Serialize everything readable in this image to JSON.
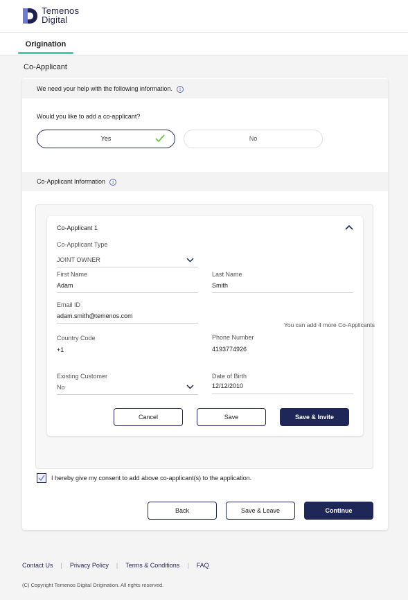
{
  "brand": {
    "name_line1": "Temenos",
    "name_line2": "Digital",
    "accent_color": "#3dcfab",
    "primary_color": "#1e2758"
  },
  "tabs": [
    {
      "label": "Origination",
      "active": true
    }
  ],
  "page_title": "Co-Applicant",
  "help_strip": {
    "text": "We need your help with the following information.",
    "icon": "info-icon"
  },
  "question": {
    "text": "Would you like to add a co-applicant?",
    "options": [
      {
        "label": "Yes",
        "selected": true,
        "icon": "check-icon"
      },
      {
        "label": "No",
        "selected": false
      }
    ]
  },
  "section_strip": {
    "text": "Co-Applicant Information",
    "icon": "info-icon"
  },
  "applicant": {
    "title": "Co-Applicant 1",
    "expanded_icon": "chevron-up-icon",
    "type": {
      "label": "Co-Applicant Type",
      "value": "JOINT OWNER",
      "icon": "chevron-down-icon"
    },
    "first_name": {
      "label": "First Name",
      "value": "Adam"
    },
    "last_name": {
      "label": "Last Name",
      "value": "Smith"
    },
    "email": {
      "label": "Email ID",
      "value": "adam.smith@temenos.com"
    },
    "country_code": {
      "label": "Country Code",
      "value": "+1"
    },
    "phone": {
      "label": "Phone Number",
      "value": "4193774926"
    },
    "existing_customer": {
      "label": "Existing Customer",
      "value": "No",
      "icon": "chevron-down-icon"
    },
    "dob": {
      "label": "Date of Birth",
      "value": "12/12/2010"
    },
    "buttons": {
      "cancel": "Cancel",
      "save": "Save",
      "save_invite": "Save & Invite"
    }
  },
  "more_note": "You can add 4 more Co-Applicants",
  "consent": {
    "text": "I hereby give my consent to add above co-applicant(s) to the application.",
    "checked": true
  },
  "actions": {
    "back": "Back",
    "save_leave": "Save & Leave",
    "continue": "Continue"
  },
  "footer": {
    "links": [
      "Contact Us",
      "Privacy Policy",
      "Terms & Conditions",
      "FAQ"
    ],
    "separator": "|",
    "copyright": "(C) Copyright Temenos Digital Origination. All rights reserved."
  }
}
